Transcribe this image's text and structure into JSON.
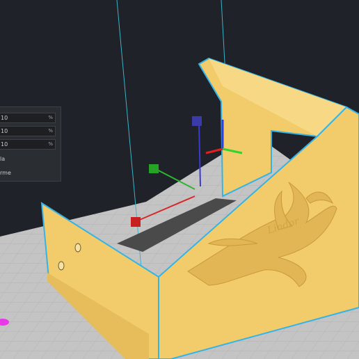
{
  "scale_panel": {
    "fields": [
      {
        "value": "10",
        "unit": "%"
      },
      {
        "value": "10",
        "unit": "%"
      },
      {
        "value": "10",
        "unit": "%"
      }
    ],
    "option_1": "la",
    "option_2": "rme"
  },
  "model": {
    "engraving_text": "Lindor"
  },
  "colors": {
    "background": "#1f2329",
    "build_plate": "#c4c4c4",
    "model": "#f2cb6b",
    "selection_outline": "#34b3e6",
    "axis_x": "#d62828",
    "axis_y": "#2fb52f",
    "axis_z": "#3b3bd1"
  },
  "icons": [
    "move-gizmo-x-handle",
    "move-gizmo-y-handle",
    "move-gizmo-z-handle",
    "origin-axis-indicator",
    "build-volume-edge",
    "offscreen-model-marker"
  ]
}
